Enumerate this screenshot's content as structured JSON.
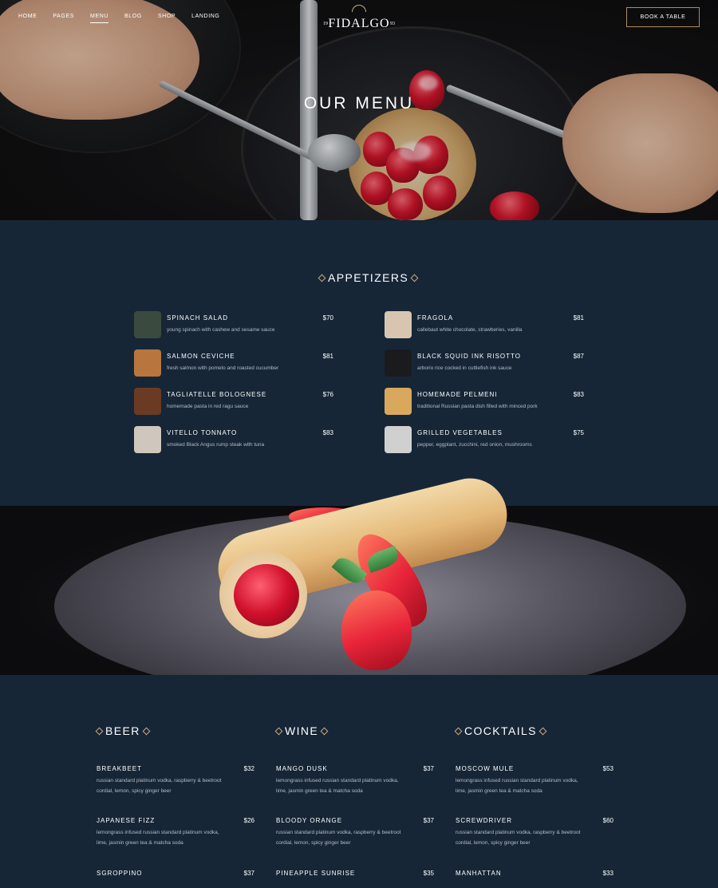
{
  "nav": {
    "items": [
      {
        "label": "HOME"
      },
      {
        "label": "PAGES"
      },
      {
        "label": "MENU"
      },
      {
        "label": "BLOG"
      },
      {
        "label": "SHOP"
      },
      {
        "label": "LANDING"
      }
    ]
  },
  "logo": {
    "name": "FIDALGO",
    "year_left": "19",
    "year_right": "93"
  },
  "book_button": "BOOK A TABLE",
  "hero_title": "OUR MENU",
  "appetizers": {
    "heading": "APPETIZERS",
    "items": [
      {
        "name": "SPINACH SALAD",
        "desc": "young spinach with cashew and sesame sauce",
        "price": "$70"
      },
      {
        "name": "FRAGOLA",
        "desc": "callebaut white chocolate, strawberies, vanilla",
        "price": "$81"
      },
      {
        "name": "SALMON CEVICHE",
        "desc": "fresh salmon with pomelo and roasted cucumber",
        "price": "$81"
      },
      {
        "name": "BLACK SQUID INK RISOTTO",
        "desc": "arborio rice cocked in cuttlefish ink sauce",
        "price": "$87"
      },
      {
        "name": "TAGLIATELLE BOLOGNESE",
        "desc": "homemade pasta in red ragu sauce",
        "price": "$76"
      },
      {
        "name": "HOMEMADE PELMENI",
        "desc": "traditional Russian pasta dish filled with minced pork",
        "price": "$83"
      },
      {
        "name": "VITELLO TONNATO",
        "desc": "smoked Black Angus rump steak with tuna",
        "price": "$83"
      },
      {
        "name": "GRILLED VEGETABLES",
        "desc": "pepper, eggplant, zucchini, red onion, mushrooms",
        "price": "$75"
      }
    ]
  },
  "drinks": [
    {
      "heading": "BEER",
      "items": [
        {
          "name": "BREAKBEET",
          "desc": "russian standard platinum vodka, raspberry & beetroot cordial, lemon, spicy ginger beer",
          "price": "$32"
        },
        {
          "name": "JAPANESE FIZZ",
          "desc": "lemongrass infused russian standard platinum vodka, lime, jasmin green tea & matcha soda",
          "price": "$26"
        },
        {
          "name": "SGROPPINO",
          "desc": "",
          "price": "$37"
        }
      ]
    },
    {
      "heading": "WINE",
      "items": [
        {
          "name": "MANGO DUSK",
          "desc": "lemongrass infused russian standard platinum vodka, lime, jasmin green tea & matcha soda",
          "price": "$37"
        },
        {
          "name": "BLOODY ORANGE",
          "desc": "russian standard platinum vodka, raspberry & beetroot cordial, lemon, spicy ginger beer",
          "price": "$37"
        },
        {
          "name": "PINEAPPLE SUNRISE",
          "desc": "",
          "price": "$35"
        }
      ]
    },
    {
      "heading": "COCKTAILS",
      "items": [
        {
          "name": "MOSCOW MULE",
          "desc": "lemongrass infused russian standard platinum vodka, lime, jasmin green tea & matcha soda",
          "price": "$53"
        },
        {
          "name": "SCREWDRIVER",
          "desc": "russian standard platinum vodka, raspberry & beetroot cordial, lemon, spicy ginger beer",
          "price": "$60"
        },
        {
          "name": "MANHATTAN",
          "desc": "",
          "price": "$33"
        }
      ]
    }
  ],
  "colors": {
    "background": "#162637",
    "accent_gold": "#c8a97d",
    "button_border": "#b08a62",
    "muted_text": "#b5bcc5"
  }
}
